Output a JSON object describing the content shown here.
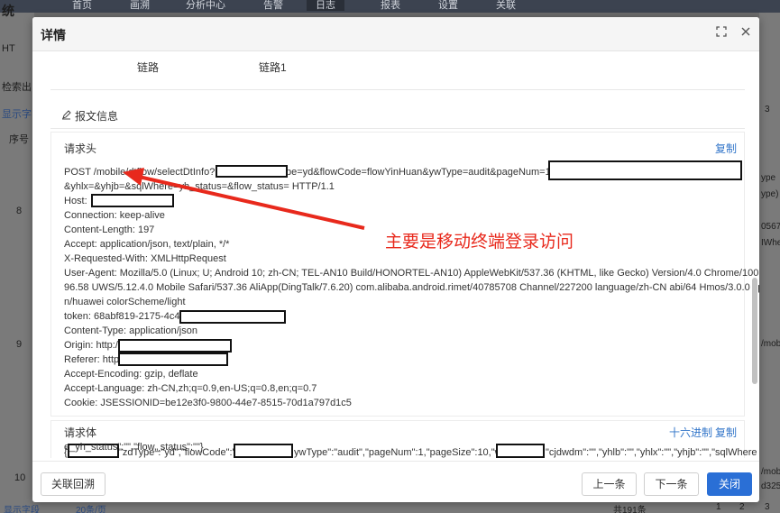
{
  "background": {
    "nav_items": [
      "首页",
      "画溯",
      "分析中心",
      "告警",
      "日志",
      "报表",
      "设置",
      "关联"
    ],
    "left_items": [
      "统",
      "HT",
      "检索出",
      "显示字",
      "序号",
      "8",
      "9",
      "10",
      "显示字段"
    ],
    "right_items": [
      "3",
      "ype",
      "ype)",
      "0567",
      "IWhe",
      "/mob",
      "/mob",
      "d325"
    ],
    "bottom_items": [
      "显示字段",
      "20条/页",
      "共191条",
      "1",
      "2",
      "3"
    ]
  },
  "modal": {
    "title": "详情",
    "maximize_icon": "maximize-icon",
    "close_icon": "close-icon",
    "top_row": {
      "label": "链路",
      "value": "链路1"
    },
    "section_title": "报文信息",
    "request_header": {
      "title": "请求头",
      "copy_label": "复制",
      "lines": [
        "POST   /mobile/dtflow/selectDtInfo?",
        "pe=yd&flowCode=flowYinHuan&ywType=audit&pageNum=1&p",
        "&yhlx=&yhjb=&sqlWhere=yh_status=&flow_status=   HTTP/1.1",
        "Host: ",
        "Connection: keep-alive",
        "Content-Length: 197",
        "Accept: application/json, text/plain, */*",
        "X-Requested-With: XMLHttpRequest",
        "User-Agent: Mozilla/5.0 (Linux; U; Android 10; zh-CN; TEL-AN10 Build/HONORTEL-AN10) AppleWebKit/537.36 (KHTML, like Gecko) Version/4.0 Chrome/100.0.48",
        "96.58 UWS/5.12.4.0 Mobile Safari/537.36 AliApp(DingTalk/7.6.20) com.alibaba.android.rimet/40785708 Channel/227200 language/zh-CN abi/64 Hmos/3.0.0 xp",
        "n/huawei colorScheme/light",
        "token: 68abf819-2175-4c43",
        "Content-Type: application/json",
        "Origin: http://",
        "Referer: http:",
        "Accept-Encoding: gzip, deflate",
        "Accept-Language: zh-CN,zh;q=0.9,en-US;q=0.8,en;q=0.7",
        "Cookie: JSESSIONID=be12e3f0-9800-44e7-8515-70d1a797d1c5"
      ]
    },
    "request_body": {
      "title": "请求体",
      "hex_label": "十六进制",
      "copy_label": "复制",
      "line1_a": "{",
      "line1_b": "\"zdType\":\"yd\",\"flowCode\":\"",
      "line1_c": "ywType\":\"audit\",\"pageNum\":1,\"pageSize\":10,\"wc\"",
      "line1_d": "\"cjdwdm\":\"\",\"yhlb\":\"\",\"yhlx\":\"\",\"yhjb\":\"\",\"sqlWhere",
      "line2": "e_yh_status\":\"\",\"flow_status\":\"\"}"
    },
    "annotation": "主要是移动终端登录访问",
    "footer": {
      "related_trace": "关联回溯",
      "prev": "上一条",
      "next": "下一条",
      "close": "关闭"
    }
  },
  "colors": {
    "primary": "#2a6fd6",
    "link": "#3275c9",
    "annotation": "#e8291c"
  }
}
